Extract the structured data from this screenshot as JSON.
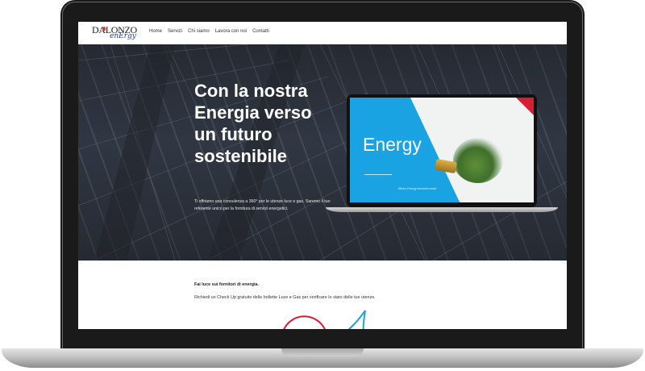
{
  "site": {
    "logo": {
      "main": "DALONZO",
      "sub": "enErgy"
    },
    "nav": {
      "items": [
        "Home",
        "Servizi",
        "Chi siamo",
        "Lavora con noi",
        "Contatti"
      ]
    },
    "hero": {
      "title": "Con la nostra Energia verso un futuro sostenibile",
      "text": "Ti offriamo una consulenza a 360° per le utenze luce e gas. Saremo il tuo referente unico per la fornitura di servizi energetici."
    },
    "mockup": {
      "word": "Energy",
      "caption": "Where Energy becomes smart"
    },
    "content": {
      "heading": "Fai luce sui fornitori di energia.",
      "text": "Richiedi un Check Up gratuito delle bollette Luce e Gas per verificare lo stato delle tue utenze."
    }
  },
  "colors": {
    "accent_blue": "#1aa3e3",
    "accent_red": "#d61e37",
    "brand_navy": "#253a7a"
  },
  "icons": [
    "logo-drop-icon",
    "lightbulb-image",
    "red-arc-decoration",
    "blue-arrow-decoration"
  ]
}
